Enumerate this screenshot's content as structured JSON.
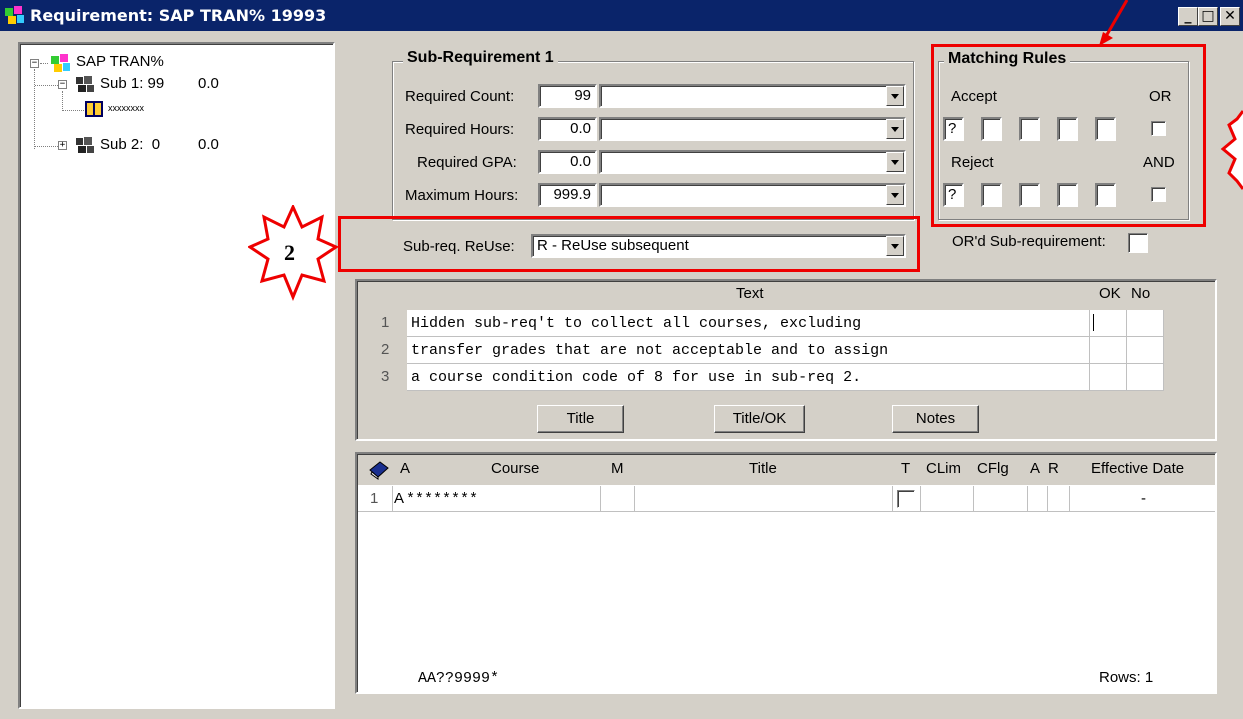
{
  "window": {
    "title": "Requirement: SAP TRAN% 19993",
    "minimize_label": "_",
    "maximize_label": "□",
    "close_label": "✕"
  },
  "tree": {
    "root_label": "SAP TRAN%",
    "items": [
      {
        "label": "Sub 1: 99",
        "value": "0.0",
        "expander": "−"
      },
      {
        "label": "xxxxxxxx"
      },
      {
        "label": "Sub 2:  0",
        "value": "0.0",
        "expander": "+"
      }
    ]
  },
  "subreq": {
    "group_title": "Sub-Requirement 1",
    "rows": [
      {
        "label": "Required Count:",
        "value": "99",
        "combo": ""
      },
      {
        "label": "Required Hours:",
        "value": "0.0",
        "combo": ""
      },
      {
        "label": "Required GPA:",
        "value": "0.0",
        "combo": ""
      },
      {
        "label": "Maximum Hours:",
        "value": "999.9",
        "combo": ""
      }
    ],
    "reuse_label": "Sub-req. ReUse:",
    "reuse_value": "R - ReUse subsequent"
  },
  "matching": {
    "group_title": "Matching Rules",
    "accept_label": "Accept",
    "or_label": "OR",
    "accept_first": "?",
    "reject_label": "Reject",
    "and_label": "AND",
    "reject_first": "?"
  },
  "ord_subreq_label": "OR'd Sub-requirement:",
  "callouts": {
    "two": "2"
  },
  "text_grid": {
    "headers": {
      "text": "Text",
      "ok": "OK",
      "no": "No"
    },
    "rows": [
      {
        "num": "1",
        "text": "Hidden sub-req't to collect all courses, excluding"
      },
      {
        "num": "2",
        "text": "transfer grades that are not acceptable and to assign"
      },
      {
        "num": "3",
        "text": "a course condition code of 8 for use in sub-req 2."
      }
    ],
    "buttons": {
      "title": "Title",
      "title_ok": "Title/OK",
      "notes": "Notes"
    }
  },
  "course_grid": {
    "headers": {
      "a": "A",
      "course": "Course",
      "m": "M",
      "title": "Title",
      "t": "T",
      "clim": "CLim",
      "cflg": "CFlg",
      "a2": "A",
      "r": "R",
      "effective_date": "Effective Date"
    },
    "rows": [
      {
        "num": "1",
        "a": "A",
        "course": "********",
        "effective_date": "-"
      }
    ],
    "footer_pattern": "AA??9999*",
    "rows_count": "Rows: 1"
  },
  "colors": {
    "titlebar": "#0a246a",
    "face": "#d4d0c8",
    "highlight": "#ee0000"
  }
}
